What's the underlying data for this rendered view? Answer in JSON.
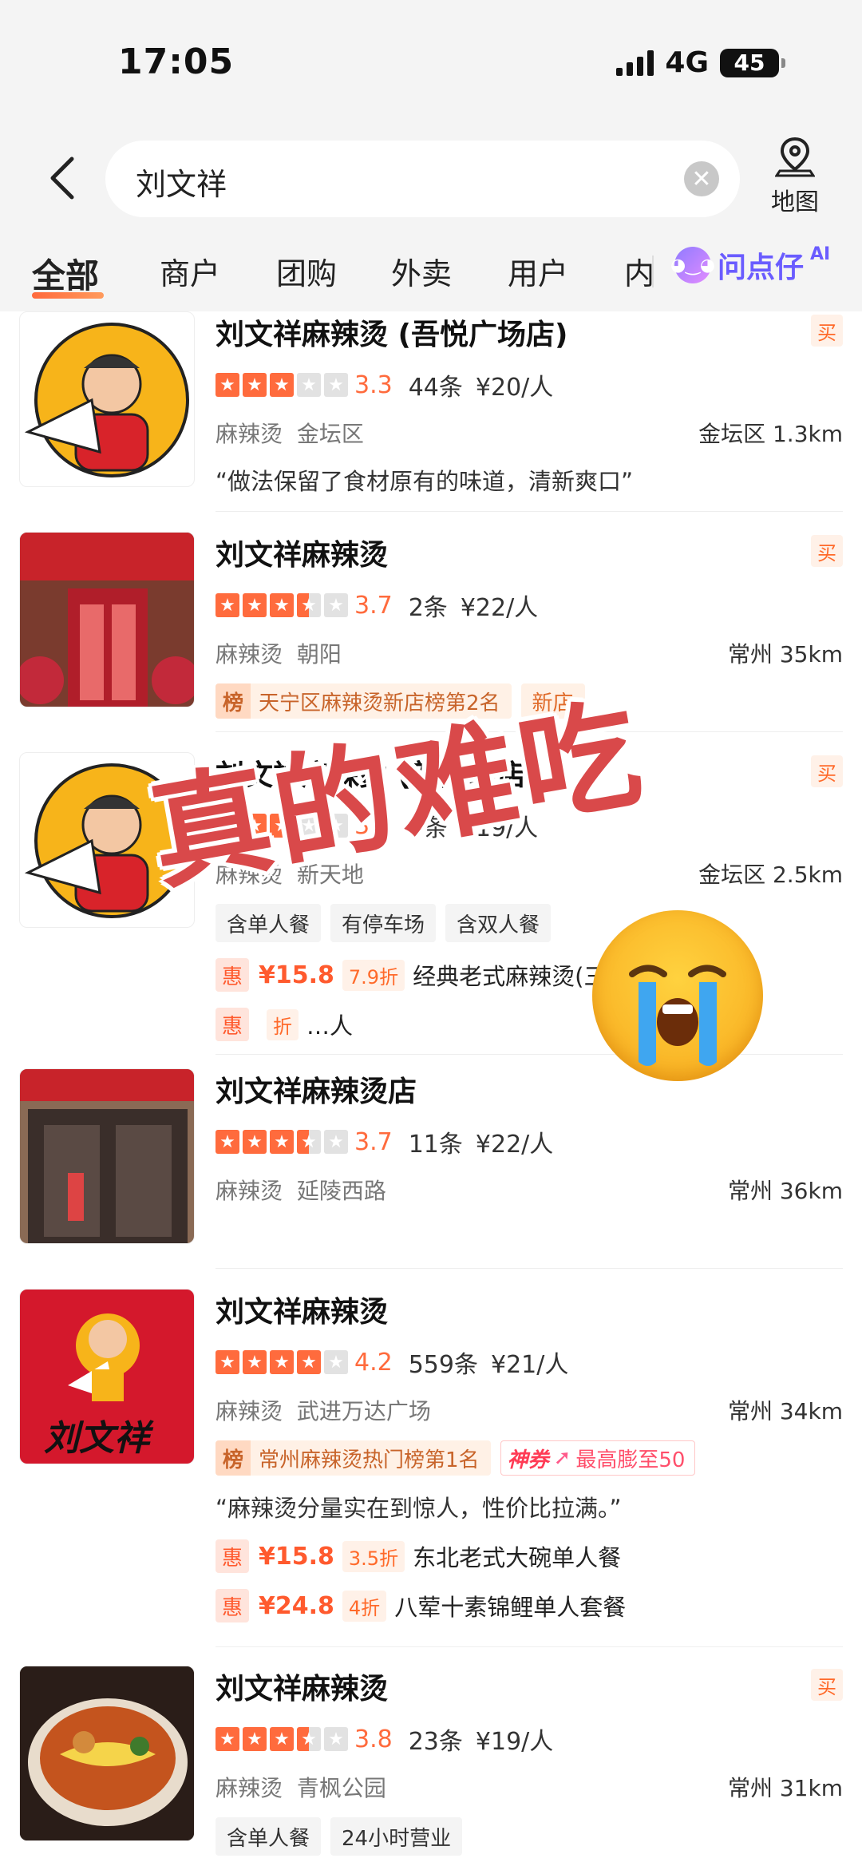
{
  "status": {
    "time": "17:05",
    "network": "4G",
    "battery": "45"
  },
  "search": {
    "query": "刘文祥",
    "map_label": "地图"
  },
  "tabs": [
    "全部",
    "商户",
    "团购",
    "外卖",
    "用户",
    "内"
  ],
  "ai_tab": {
    "label": "问点仔",
    "sup": "AI"
  },
  "buy_label": "买",
  "deal_icon": "惠",
  "rank_icon": "榜",
  "shops": [
    {
      "name": "刘文祥麻辣烫 (吾悦广场店)",
      "stars": 3.3,
      "score": "3.3",
      "reviews": "44条",
      "price": "¥20/人",
      "category": "麻辣烫",
      "area": "金坛区",
      "distance": "金坛区 1.3km",
      "quote": "“做法保留了食材原有的味道，清新爽口”"
    },
    {
      "name": "刘文祥麻辣烫",
      "stars": 3.7,
      "score": "3.7",
      "reviews": "2条",
      "price": "¥22/人",
      "category": "麻辣烫",
      "area": "朝阳",
      "distance": "常州 35km",
      "rank": "天宁区麻辣烫新店榜第2名",
      "new_badge": "新店"
    },
    {
      "name": "刘文祥麻辣烫 (新天地店)",
      "stars": 3.2,
      "score": "3.2",
      "reviews": "8条",
      "price": "¥19/人",
      "category": "麻辣烫",
      "area": "新天地",
      "distance": "金坛区 2.5km",
      "chips": [
        "含单人餐",
        "有停车场",
        "含双人餐"
      ],
      "deals": [
        {
          "price": "¥15.8",
          "discount": "7.9折",
          "name": "经典老式麻辣烫(三"
        },
        {
          "price": "",
          "discount": "折",
          "name": "…人"
        }
      ]
    },
    {
      "name": "刘文祥麻辣烫店",
      "stars": 3.7,
      "score": "3.7",
      "reviews": "11条",
      "price": "¥22/人",
      "category": "麻辣烫",
      "area": "延陵西路",
      "distance": "常州 36km"
    },
    {
      "name": "刘文祥麻辣烫",
      "stars": 4.2,
      "score": "4.2",
      "reviews": "559条",
      "price": "¥21/人",
      "category": "麻辣烫",
      "area": "武进万达广场",
      "distance": "常州 34km",
      "rank": "常州麻辣烫热门榜第1名",
      "shen": {
        "label": "神券",
        "text": "最高膨至50"
      },
      "quote": "“麻辣烫分量实在到惊人，性价比拉满。”",
      "deals": [
        {
          "price": "¥15.8",
          "discount": "3.5折",
          "name": "东北老式大碗单人餐"
        },
        {
          "price": "¥24.8",
          "discount": "4折",
          "name": "八荤十素锦鲤单人套餐"
        }
      ]
    },
    {
      "name": "刘文祥麻辣烫",
      "stars": 3.8,
      "score": "3.8",
      "reviews": "23条",
      "price": "¥19/人",
      "category": "麻辣烫",
      "area": "青枫公园",
      "distance": "常州 31km",
      "chips": [
        "含单人餐",
        "24小时营业"
      ]
    }
  ],
  "overlay": {
    "text": "真的难吃",
    "emoji": "loudly-crying-face"
  },
  "thumb_logo_text": "刘文祥",
  "colors": {
    "accent": "#ff6b3d",
    "overlay": "#d9494a",
    "ai": "#6a5cff"
  }
}
